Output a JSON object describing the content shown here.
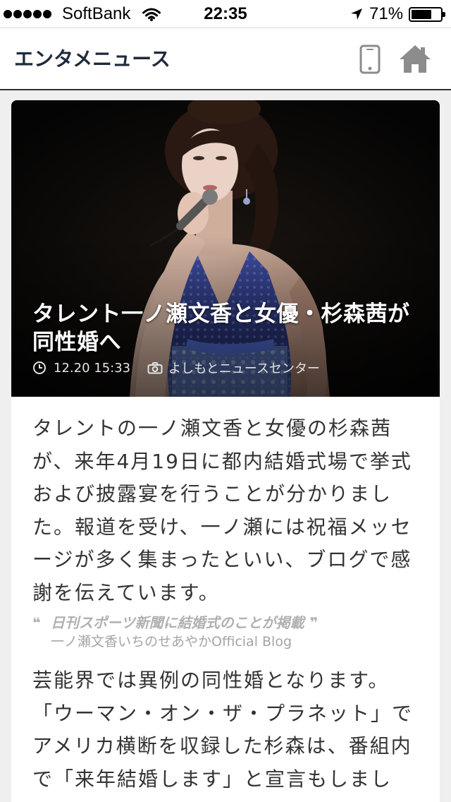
{
  "status_bar": {
    "signal_strength": 5,
    "signal_max": 5,
    "carrier": "SoftBank",
    "time": "22:35",
    "battery_label": "71%",
    "battery_level": 0.71,
    "icons": {
      "wifi": "wifi-icon",
      "location": "location-arrow-icon",
      "battery": "battery-icon"
    }
  },
  "header": {
    "title": "エンタメニュース",
    "icons": {
      "device": "smartphone-icon",
      "home": "home-icon"
    }
  },
  "article": {
    "title": "タレント一ノ瀬文香と女優・杉森茜が同性婚へ",
    "published": "12.20 15:33",
    "credit": "よしもとニュースセンター",
    "meta_icons": {
      "published": "clock-icon",
      "credit": "camera-icon"
    },
    "paragraphs": [
      "タレントの一ノ瀬文香と女優の杉森茜が、来年4月19日に都内結婚式場で挙式および披露宴を行うことが分かりました。報道を受け、一ノ瀬には祝福メッセージが多く集まったといい、ブログで感謝を伝えています。",
      "芸能界では異例の同性婚となります。「ウーマン・オン・ザ・プラネット」でアメリカ横断を収録した杉森は、番組内で「来年結婚します」と宣言もしまし"
    ],
    "quote": {
      "open_mark": "❝",
      "text": "日刊スポーツ新聞に結婚式のことが掲載",
      "close_mark": "❞",
      "source": "一ノ瀬文香いちのせあやかOfficial Blog"
    }
  },
  "colors": {
    "page_background": "#efefef",
    "header_title": "#1f2a3c",
    "header_icons": "#8c8c8c",
    "body_text": "#333333",
    "quote_text": "#b0b0b0",
    "quote_source": "#a5a5a5"
  }
}
